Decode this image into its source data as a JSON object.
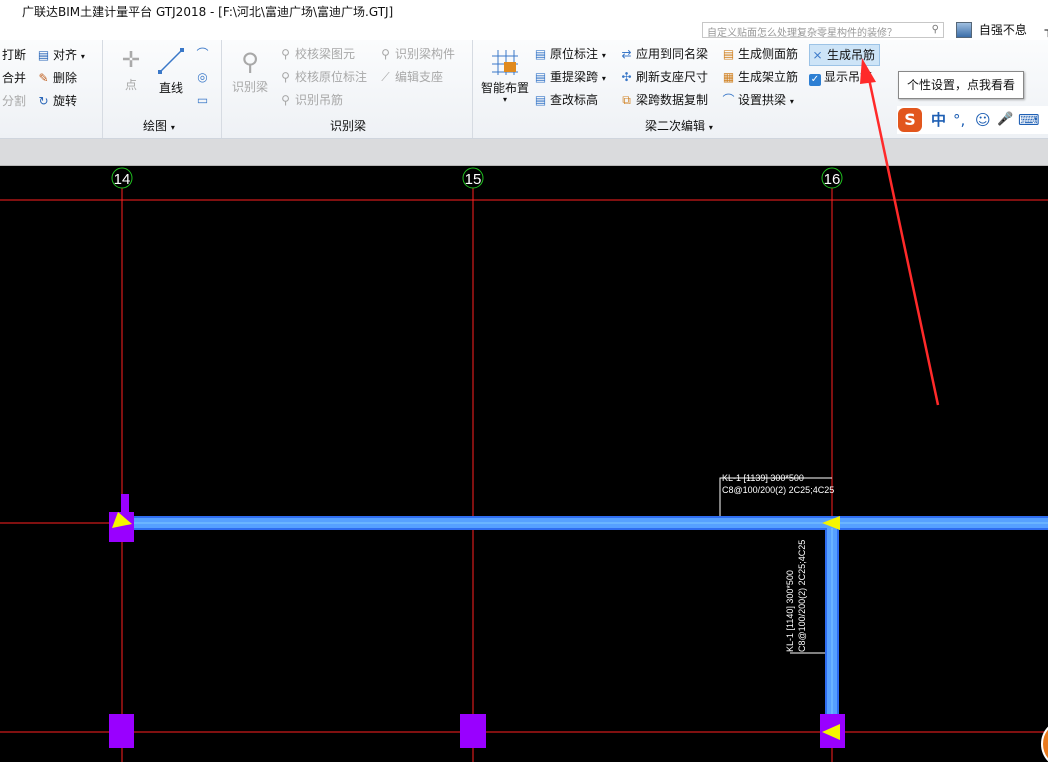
{
  "window": {
    "title": "广联达BIM土建计量平台 GTJ2018 - [F:\\河北\\富迪广场\\富迪广场.GTJ]"
  },
  "search": {
    "placeholder": "自定义贴面怎么处理复杂零星构件的装修？"
  },
  "user": {
    "name": "自强不息"
  },
  "ribbon": {
    "modify": {
      "items": [
        "打断",
        "对齐",
        "合并",
        "删除",
        "分割",
        "旋转"
      ]
    },
    "draw": {
      "point": "点",
      "line": "直线",
      "label": "绘图"
    },
    "identify_beam": {
      "big_button": "识别梁",
      "items": [
        "校核梁图元",
        "识别梁构件",
        "校核原位标注",
        "编辑支座",
        "识别吊筋"
      ],
      "label": "识别梁"
    },
    "beam_edit": {
      "big_button": "智能布置",
      "items": [
        "原位标注",
        "应用到同名梁",
        "生成侧面筋",
        "生成吊筋",
        "重提梁跨",
        "刷新支座尺寸",
        "生成架立筋",
        "显示吊筋",
        "查改标高",
        "梁跨数据复制",
        "设置拱梁"
      ],
      "label": "梁二次编辑"
    }
  },
  "tooltip": {
    "text": "个性设置，点我看看"
  },
  "ime": {
    "logo": "S",
    "lang": "中",
    "punct": "°,",
    "emoji": "☺",
    "mic": "🎤",
    "kbd": "⌨"
  },
  "canvas": {
    "axes": [
      "14",
      "15",
      "16"
    ],
    "beam_label_h": {
      "line1": "KL-1 [1139] 300*500",
      "line2": "C8@100/200(2) 2C25;4C25"
    },
    "beam_label_v": {
      "line1": "KL-1 [1140] 300*500",
      "line2": "C8@100/200(2) 2C25;4C25"
    },
    "colors": {
      "background": "#000000",
      "axis": "#ff2020",
      "beam": "#4c8fff",
      "column": "#9900ff",
      "marker": "#f5f500"
    }
  }
}
